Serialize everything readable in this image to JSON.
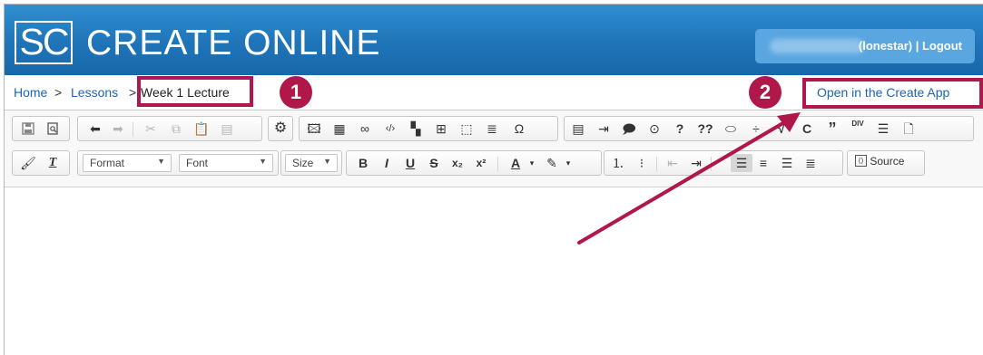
{
  "header": {
    "logo_text": "SC",
    "title": "CREATE ONLINE",
    "user_label": "(lonestar) | Logout"
  },
  "breadcrumb": {
    "home": "Home",
    "separator": ">",
    "lessons": "Lessons",
    "current": "Week 1 Lecture"
  },
  "open_app_link": "Open in the Create App",
  "annotations": {
    "badge_1": "1",
    "badge_2": "2",
    "highlight_color": "#b0184a"
  },
  "toolbar": {
    "format_label": "Format",
    "font_label": "Font",
    "size_label": "Size",
    "source_label": "Source",
    "row1": {
      "doc": [
        "save-icon",
        "preview-icon"
      ],
      "clipboard": [
        "undo-icon",
        "redo-icon",
        "cut-icon",
        "copy-icon",
        "paste-icon",
        "paste-text-icon"
      ],
      "plugin": [
        "gear-icon"
      ],
      "insert": [
        "image-icon",
        "media-icon",
        "link-icon",
        "code-icon",
        "widget-icon",
        "table-icon",
        "bookmark-icon",
        "line-spacing-icon",
        "omega-icon"
      ],
      "custom_glyphs": [
        "?",
        "??",
        "C",
        "DIV"
      ]
    },
    "row2": {
      "text_style": [
        "B",
        "I",
        "U",
        "S",
        "x₂",
        "x²"
      ],
      "color_labels": [
        "A",
        "✎"
      ]
    }
  },
  "colors": {
    "header_top": "#2f8fd0",
    "header_bottom": "#1768a9",
    "link": "#1c64b9"
  }
}
